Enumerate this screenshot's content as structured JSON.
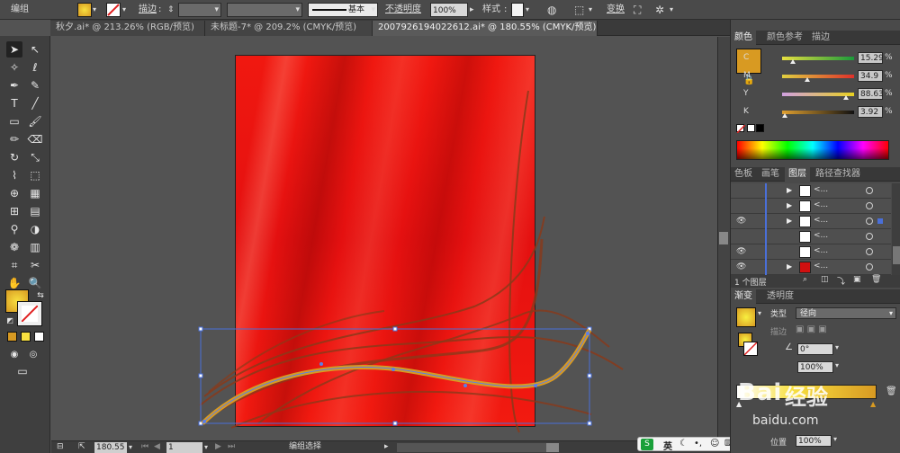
{
  "control_bar": {
    "selection_label": "编组",
    "stroke_label": "描边",
    "stroke_profile": "基本",
    "opacity_label": "不透明度",
    "opacity_value": "100%",
    "style_label": "样式",
    "transform_label": "变换"
  },
  "tabs": [
    {
      "label": "秋夕.ai* @ 213.26% (RGB/预览)",
      "active": false
    },
    {
      "label": "未标题-7* @ 209.2% (CMYK/预览)",
      "active": false
    },
    {
      "label": "2007926194022612.ai* @ 180.55% (CMYK/预览)",
      "active": true
    }
  ],
  "color_panel": {
    "tabs": [
      "颜色",
      "颜色参考",
      "描边"
    ],
    "fill_color": "#d89a22",
    "sliders": [
      {
        "label": "C",
        "value": "15.29",
        "position": 0.15,
        "gradient": "linear-gradient(90deg,#e8e040,#1a9a3a)"
      },
      {
        "label": "M",
        "value": "34.9",
        "position": 0.35,
        "gradient": "linear-gradient(90deg,#e0d040,#e0302a)"
      },
      {
        "label": "Y",
        "value": "88.63",
        "position": 0.89,
        "gradient": "linear-gradient(90deg,#d0a0e0,#e8d020)"
      },
      {
        "label": "K",
        "value": "3.92",
        "position": 0.04,
        "gradient": "linear-gradient(90deg,#e0a030,#111111)"
      }
    ],
    "percent_sign": "%"
  },
  "layers_panel": {
    "tabs": [
      "色板",
      "画笔",
      "图层",
      "路径查找器"
    ],
    "rows": [
      {
        "eye": false,
        "arrow": true,
        "thumb": "#ffffff",
        "name": "<...",
        "selected": false
      },
      {
        "eye": false,
        "arrow": true,
        "thumb": "#ffffff",
        "name": "<...",
        "selected": false
      },
      {
        "eye": true,
        "arrow": true,
        "thumb": "#ffffff",
        "name": "<...",
        "selected": true
      },
      {
        "eye": false,
        "arrow": false,
        "thumb": "#ffffff",
        "name": "<...",
        "selected": false
      },
      {
        "eye": true,
        "arrow": false,
        "thumb": "#ffffff",
        "name": "<...",
        "selected": false
      },
      {
        "eye": true,
        "arrow": true,
        "thumb": "#d01010",
        "name": "<...",
        "selected": false
      }
    ],
    "footer": "1 个图层"
  },
  "gradient_panel": {
    "tabs": [
      "渐变",
      "透明度"
    ],
    "type_label": "类型",
    "type_value": "径向",
    "stroke_label": "描边",
    "angle_value": "0°",
    "ratio_value": "100%",
    "position_label": "位置",
    "position_value": "100%"
  },
  "status_bar": {
    "zoom": "180.55",
    "page": "1",
    "mode": "编组选择"
  },
  "watermark": {
    "brand": "经验",
    "domain": "baidu.com"
  },
  "ime": {
    "lang": "英"
  }
}
